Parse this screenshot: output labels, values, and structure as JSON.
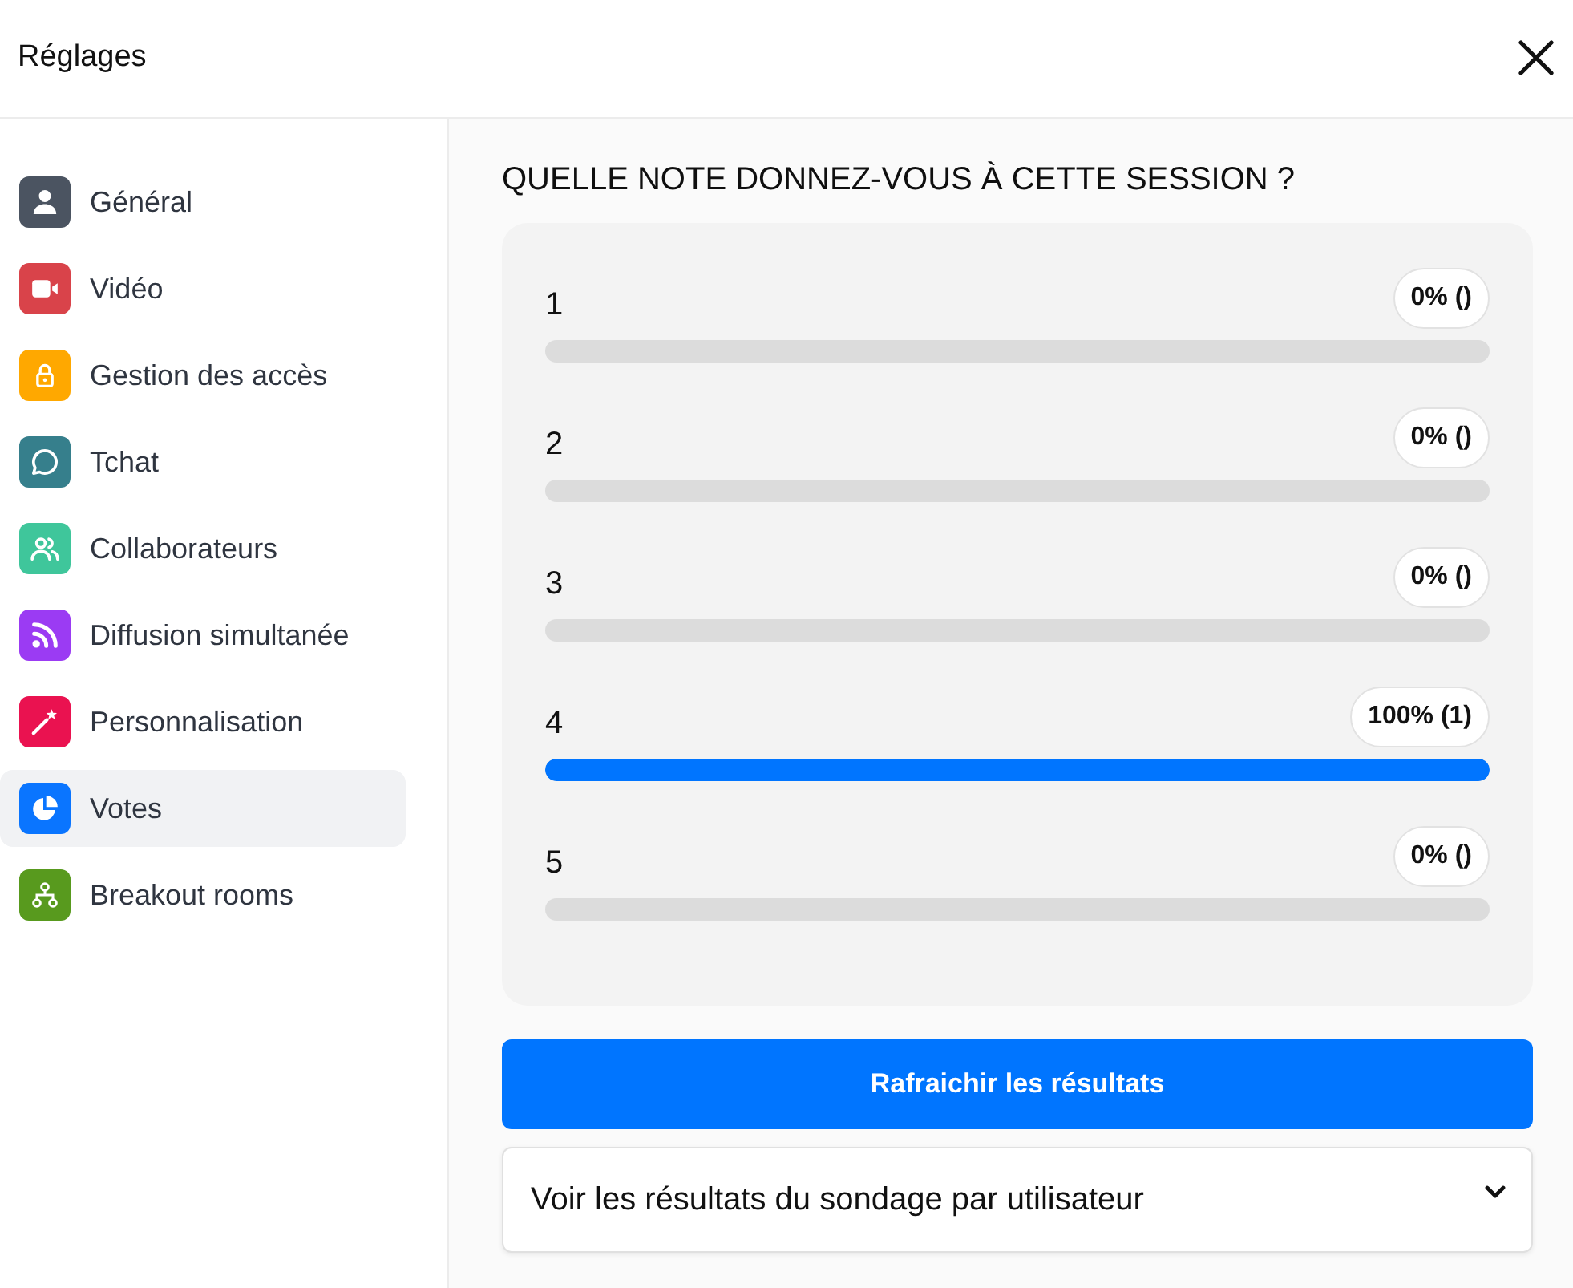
{
  "window": {
    "title": "Réglages"
  },
  "sidebar": {
    "items": [
      {
        "label": "Général",
        "color": "#4b5461",
        "selected": false
      },
      {
        "label": "Vidéo",
        "color": "#d9434a",
        "selected": false
      },
      {
        "label": "Gestion des accès",
        "color": "#ffa800",
        "selected": false
      },
      {
        "label": "Tchat",
        "color": "#367f8c",
        "selected": false
      },
      {
        "label": "Collaborateurs",
        "color": "#3fc69b",
        "selected": false
      },
      {
        "label": "Diffusion simultanée",
        "color": "#9b3bf3",
        "selected": false
      },
      {
        "label": "Personnalisation",
        "color": "#ea1250",
        "selected": false
      },
      {
        "label": "Votes",
        "color": "#0a75ff",
        "selected": true
      },
      {
        "label": "Breakout rooms",
        "color": "#589a1e",
        "selected": false
      }
    ]
  },
  "poll": {
    "question": "QUELLE NOTE DONNEZ-VOUS À CETTE SESSION ?",
    "options": [
      {
        "label": "1",
        "reading": "0% ()",
        "level": 0
      },
      {
        "label": "2",
        "reading": "0% ()",
        "level": 0
      },
      {
        "label": "3",
        "reading": "0% ()",
        "level": 0
      },
      {
        "label": "4",
        "reading": "100% (1)",
        "level": 1
      },
      {
        "label": "5",
        "reading": "0% ()",
        "level": 0
      }
    ]
  },
  "refresh_button": {
    "label": "Rafraichir les résultats"
  },
  "user_results": {
    "label": "Voir les résultats du sondage par utilisateur",
    "expanded": false
  }
}
